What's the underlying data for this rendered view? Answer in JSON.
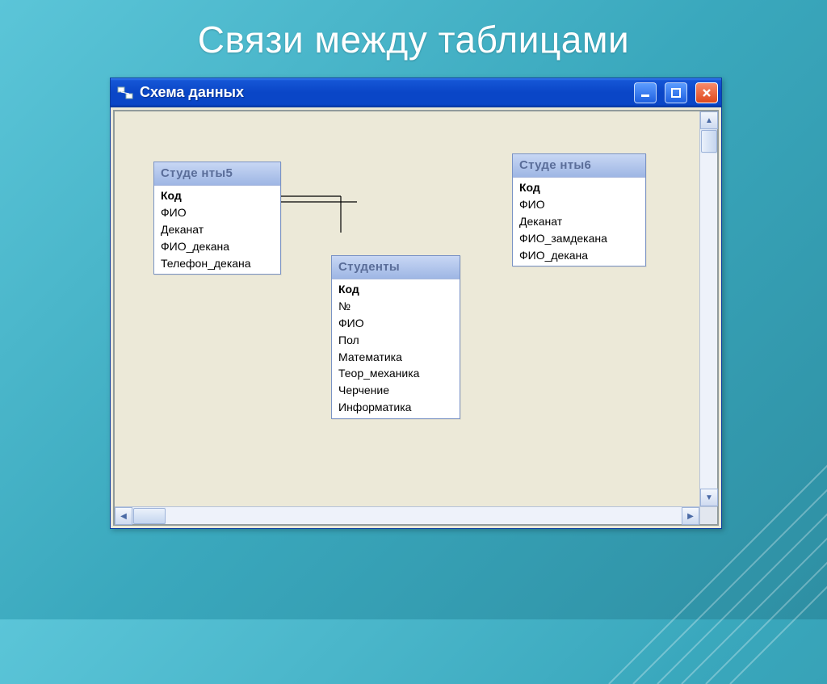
{
  "slide": {
    "title": "Связи между таблицами"
  },
  "window": {
    "title": "Схема данных"
  },
  "tables": {
    "t5": {
      "name": "Студе нты5",
      "fields": [
        "Код",
        "ФИО",
        "Деканат",
        "ФИО_декана",
        "Телефон_декана"
      ]
    },
    "t6": {
      "name": "Студе нты6",
      "fields": [
        "Код",
        "ФИО",
        "Деканат",
        "ФИО_замдекана",
        "ФИО_декана"
      ]
    },
    "tm": {
      "name": "Студенты",
      "fields": [
        "Код",
        "№",
        "ФИО",
        "Пол",
        "Математика",
        "Теор_механика",
        "Черчение",
        "Информатика"
      ]
    }
  }
}
